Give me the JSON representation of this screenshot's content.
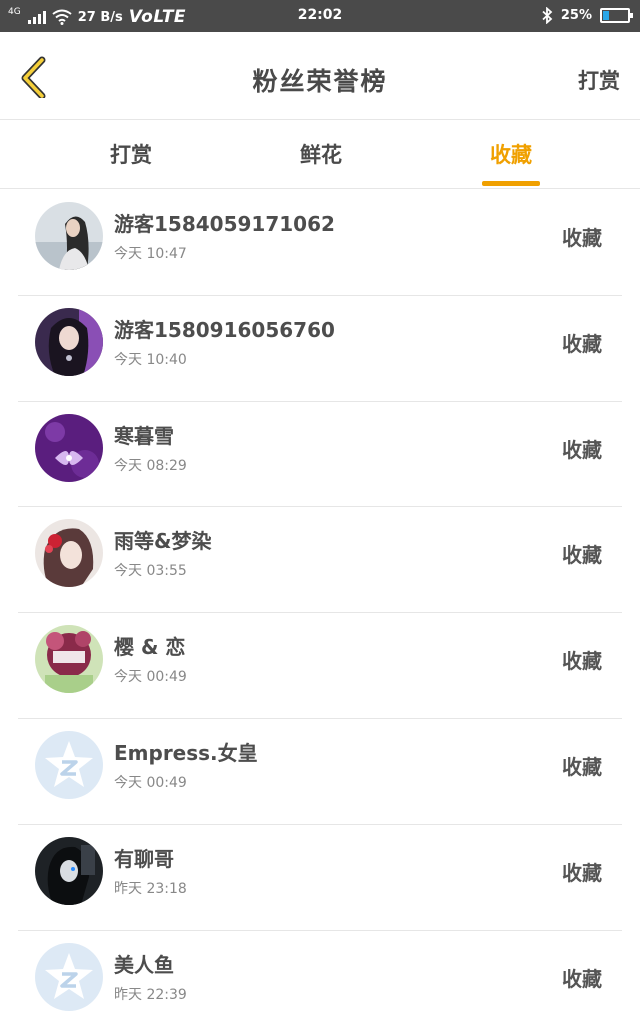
{
  "status_bar": {
    "network": "4G",
    "speed": "27 B/s",
    "volte": "VoLTE",
    "time": "22:02",
    "battery": "25%",
    "battery_level": 0.25,
    "icons": [
      "signal-icon",
      "wifi-icon",
      "bluetooth-icon",
      "battery-icon"
    ]
  },
  "header": {
    "back_icon": "chevron-left-icon",
    "title": "粉丝荣誉榜",
    "action": "打赏"
  },
  "tabs": [
    {
      "label": "打赏",
      "active": false
    },
    {
      "label": "鲜花",
      "active": false
    },
    {
      "label": "收藏",
      "active": true
    }
  ],
  "colors": {
    "accent": "#f0a000",
    "status_bar": "#4a4a4a",
    "text": "#4d4d4d",
    "divider": "#e6e6e6"
  },
  "list": [
    {
      "name": "游客1584059171062",
      "time": "今天 10:47",
      "action": "收藏",
      "avatar": "photo"
    },
    {
      "name": "游客1580916056760",
      "time": "今天 10:40",
      "action": "收藏",
      "avatar": "photo"
    },
    {
      "name": "寒暮雪",
      "time": "今天 08:29",
      "action": "收藏",
      "avatar": "photo"
    },
    {
      "name": "雨等&梦染",
      "time": "今天 03:55",
      "action": "收藏",
      "avatar": "photo"
    },
    {
      "name": "樱 & 恋",
      "time": "今天 00:49",
      "action": "收藏",
      "avatar": "photo"
    },
    {
      "name": "Empress.女皇",
      "time": "今天 00:49",
      "action": "收藏",
      "avatar": "default-qq-icon"
    },
    {
      "name": "有聊哥",
      "time": "昨天 23:18",
      "action": "收藏",
      "avatar": "photo"
    },
    {
      "name": "美人鱼",
      "time": "昨天 22:39",
      "action": "收藏",
      "avatar": "default-qq-icon"
    }
  ]
}
